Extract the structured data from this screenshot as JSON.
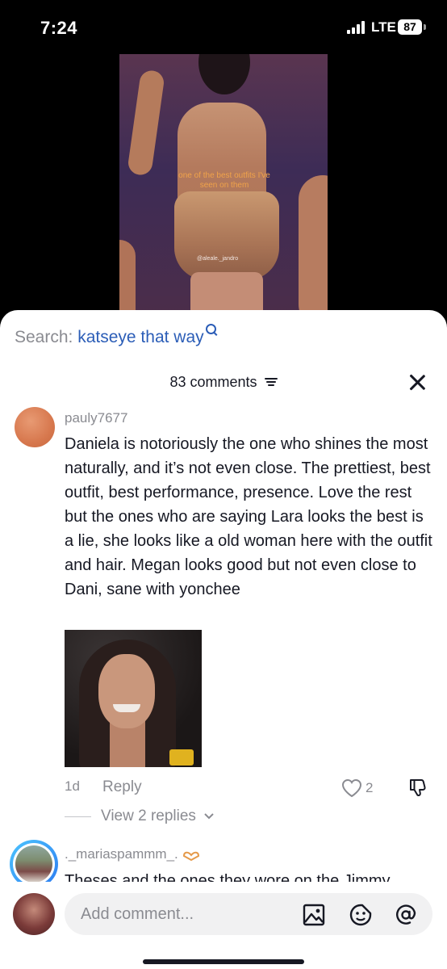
{
  "status_bar": {
    "time": "7:24",
    "network": "LTE",
    "battery": "87"
  },
  "video": {
    "caption": "one of the best outfits I've seen on them",
    "watermark": "@aleale._jandro"
  },
  "search": {
    "prefix": "Search:",
    "term": "katseye that way"
  },
  "comments_header": {
    "count_label": "83 comments"
  },
  "comments": [
    {
      "username": "pauly7677",
      "text": "Daniela is notoriously the one who shines the most naturally, and it’s not even close. The prettiest, best outfit, best performance, presence. Love the rest but the ones who are saying Lara looks the best is a lie, she looks like a old woman here with the outfit and hair. Megan looks good but not even close to Dani, sane with yonchee",
      "age": "1d",
      "reply_label": "Reply",
      "likes": "2",
      "view_replies": "View 2 replies"
    },
    {
      "username": "._mariaspammm_.",
      "text": "Theses and the ones they wore on the Jimmy"
    }
  ],
  "input": {
    "placeholder": "Add comment..."
  },
  "colors": {
    "accent": "#2b5db7",
    "muted_text": "#8a8b91",
    "primary_text": "#161823",
    "avatar_ring": "#2d7cf0"
  },
  "icons": {
    "filter": "filter-icon",
    "close": "close-icon",
    "like": "heart-icon",
    "dislike": "thumbs-down-icon",
    "image": "image-icon",
    "emoji": "emoji-icon",
    "mention": "at-icon"
  }
}
